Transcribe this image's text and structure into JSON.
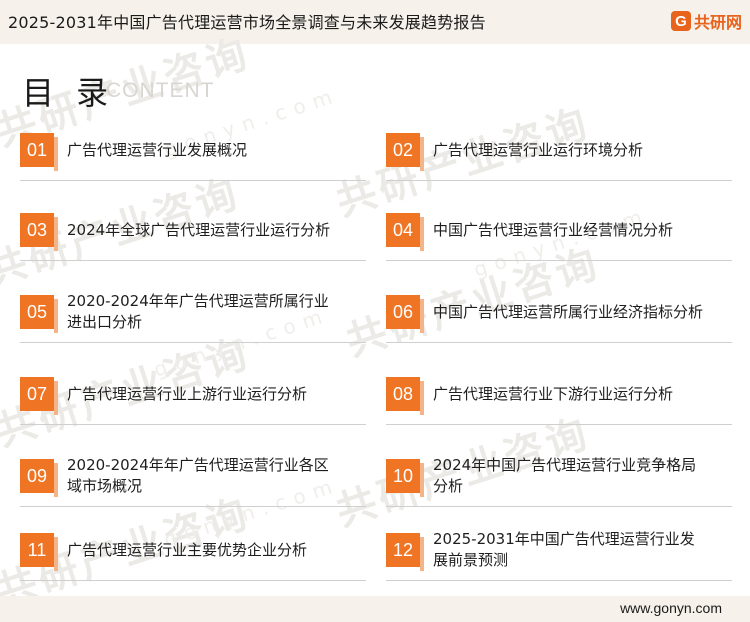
{
  "header": {
    "title": "2025-2031年中国广告代理运营市场全景调查与未来发展趋势报告",
    "logo_text": "共研网",
    "logo_mark": "G"
  },
  "toc": {
    "heading": "目 录",
    "subheading": "CONTENT",
    "items": [
      {
        "num": "01",
        "label": "广告代理运营行业发展概况"
      },
      {
        "num": "02",
        "label": "广告代理运营行业运行环境分析"
      },
      {
        "num": "03",
        "label": "2024年全球广告代理运营行业运行分析"
      },
      {
        "num": "04",
        "label": "中国广告代理运营行业经营情况分析"
      },
      {
        "num": "05",
        "label": "2020-2024年年广告代理运营所属行业进出口分析"
      },
      {
        "num": "06",
        "label": "中国广告代理运营所属行业经济指标分析"
      },
      {
        "num": "07",
        "label": "广告代理运营行业上游行业运行分析"
      },
      {
        "num": "08",
        "label": "广告代理运营行业下游行业运行分析"
      },
      {
        "num": "09",
        "label": "2020-2024年年广告代理运营行业各区域市场概况"
      },
      {
        "num": "10",
        "label": "2024年中国广告代理运营行业竞争格局分析"
      },
      {
        "num": "11",
        "label": "广告代理运营行业主要优势企业分析"
      },
      {
        "num": "12",
        "label": "2025-2031年中国广告代理运营行业发展前景预测"
      }
    ]
  },
  "watermark": {
    "text": "共研产业咨询",
    "url": "gonyn.com"
  },
  "footer": {
    "website": "www.gonyn.com"
  },
  "colors": {
    "accent": "#ef7423",
    "accent_light": "#f5b487",
    "bar_bg": "#f6f1ea"
  }
}
